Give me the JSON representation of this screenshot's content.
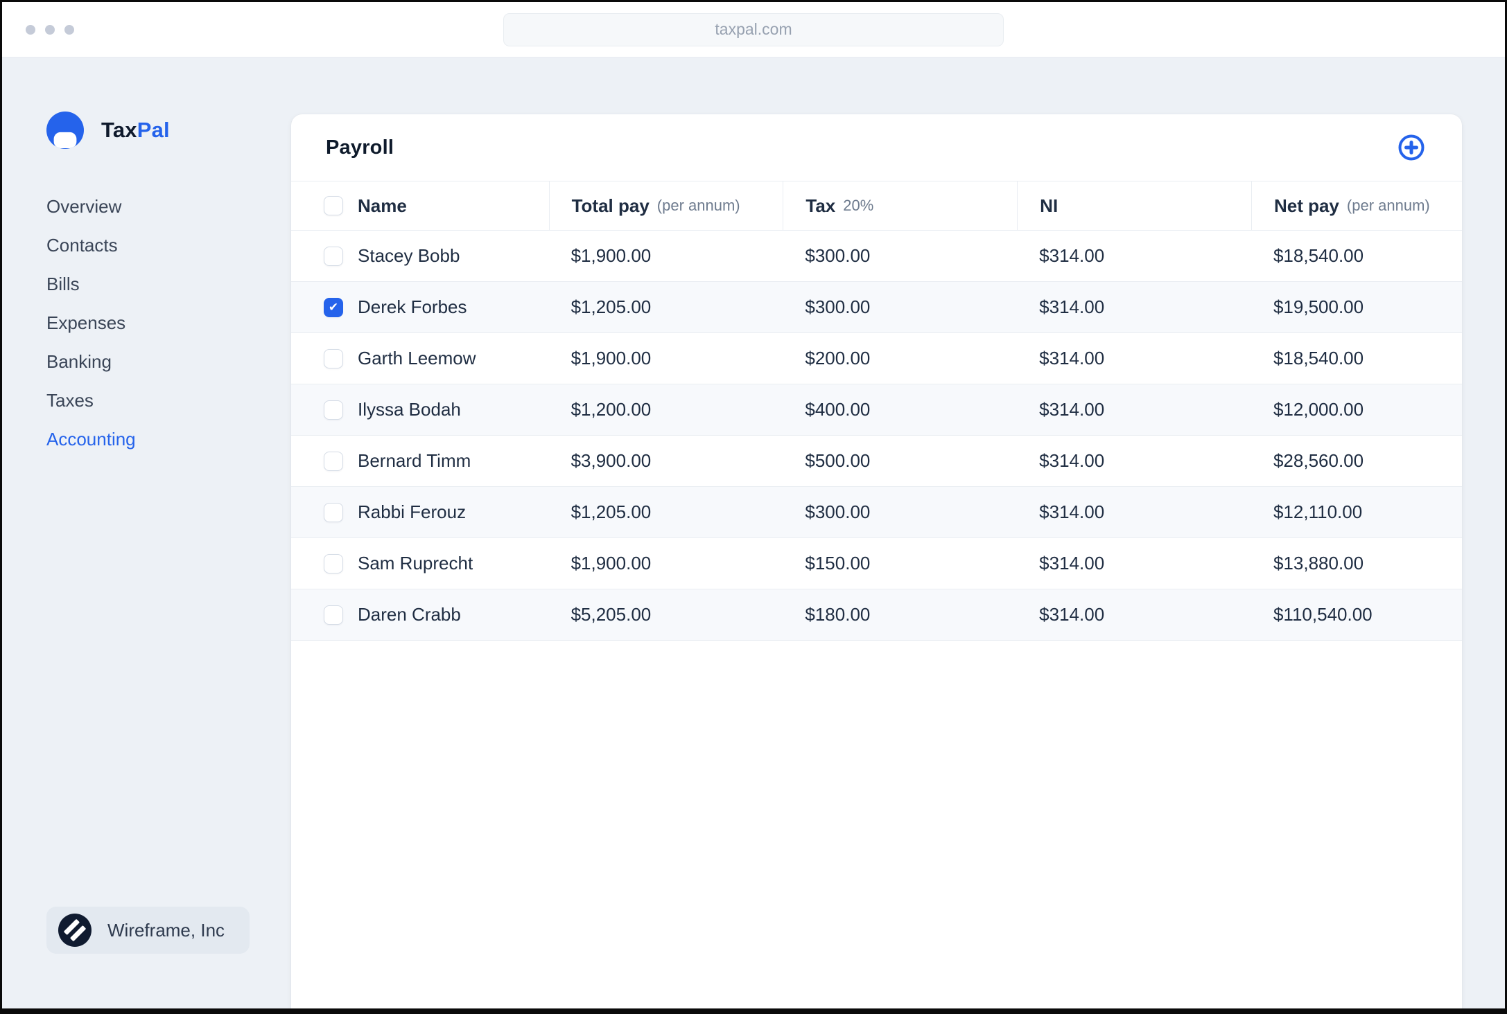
{
  "browser": {
    "url": "taxpal.com"
  },
  "brand": {
    "name_primary": "Tax",
    "name_secondary": "Pal"
  },
  "sidebar": {
    "items": [
      {
        "label": "Overview"
      },
      {
        "label": "Contacts"
      },
      {
        "label": "Bills"
      },
      {
        "label": "Expenses"
      },
      {
        "label": "Banking"
      },
      {
        "label": "Taxes"
      },
      {
        "label": "Accounting"
      }
    ],
    "active": "Accounting",
    "footer": {
      "company": "Wireframe, Inc"
    }
  },
  "payroll": {
    "title": "Payroll",
    "columns": [
      {
        "label": "Name",
        "sub": ""
      },
      {
        "label": "Total pay",
        "sub": "(per annum)"
      },
      {
        "label": "Tax",
        "sub": "20%"
      },
      {
        "label": "NI",
        "sub": ""
      },
      {
        "label": "Net pay",
        "sub": "(per annum)"
      }
    ],
    "rows": [
      {
        "name": "Stacey Bobb",
        "total_pay": "$1,900.00",
        "tax": "$300.00",
        "ni": "$314.00",
        "net_pay": "$18,540.00",
        "checked": false
      },
      {
        "name": "Derek Forbes",
        "total_pay": "$1,205.00",
        "tax": "$300.00",
        "ni": "$314.00",
        "net_pay": "$19,500.00",
        "checked": true
      },
      {
        "name": "Garth Leemow",
        "total_pay": "$1,900.00",
        "tax": "$200.00",
        "ni": "$314.00",
        "net_pay": "$18,540.00",
        "checked": false
      },
      {
        "name": "Ilyssa Bodah",
        "total_pay": "$1,200.00",
        "tax": "$400.00",
        "ni": "$314.00",
        "net_pay": "$12,000.00",
        "checked": false
      },
      {
        "name": "Bernard Timm",
        "total_pay": "$3,900.00",
        "tax": "$500.00",
        "ni": "$314.00",
        "net_pay": "$28,560.00",
        "checked": false
      },
      {
        "name": "Rabbi Ferouz",
        "total_pay": "$1,205.00",
        "tax": "$300.00",
        "ni": "$314.00",
        "net_pay": "$12,110.00",
        "checked": false
      },
      {
        "name": "Sam Ruprecht",
        "total_pay": "$1,900.00",
        "tax": "$150.00",
        "ni": "$314.00",
        "net_pay": "$13,880.00",
        "checked": false
      },
      {
        "name": "Daren Crabb",
        "total_pay": "$5,205.00",
        "tax": "$180.00",
        "ni": "$314.00",
        "net_pay": "$110,540.00",
        "checked": false
      }
    ]
  },
  "colors": {
    "accent_blue": "#2563eb",
    "dark_navy": "#0f1a2c",
    "page_background": "#edf1f6",
    "row_stripe": "#f7f9fc",
    "border": "#e9edf2"
  }
}
